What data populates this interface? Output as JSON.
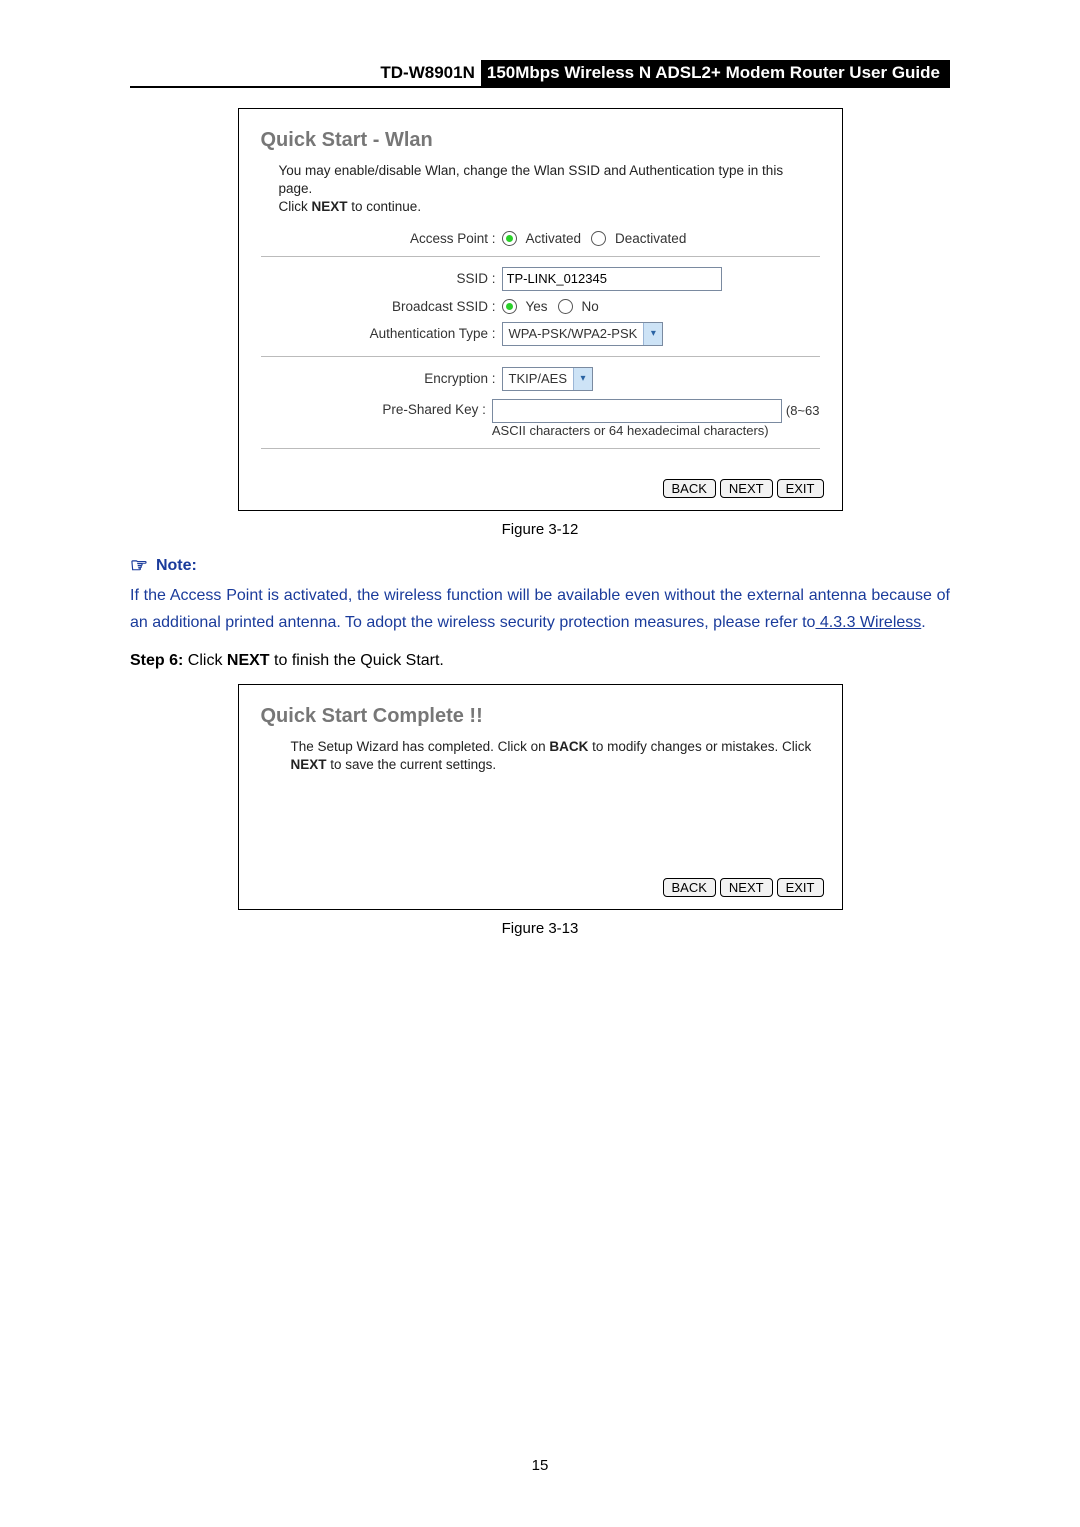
{
  "header": {
    "model": "TD-W8901N",
    "title": "150Mbps Wireless N ADSL2+ Modem Router User Guide"
  },
  "panel1": {
    "title": "Quick Start - Wlan",
    "desc_a": "You may enable/disable Wlan, change the Wlan SSID and Authentication type in this page.",
    "desc_b": "Click ",
    "desc_next": "NEXT",
    "desc_c": " to continue.",
    "ap_label": "Access Point :",
    "ap_activated": "Activated",
    "ap_deactivated": "Deactivated",
    "ssid_label": "SSID :",
    "ssid_value": "TP-LINK_012345",
    "bssid_label": "Broadcast SSID :",
    "bssid_yes": "Yes",
    "bssid_no": "No",
    "auth_label": "Authentication Type :",
    "auth_value": "WPA-PSK/WPA2-PSK",
    "enc_label": "Encryption :",
    "enc_value": "TKIP/AES",
    "psk_label": "Pre-Shared Key :",
    "psk_hint_a": "(8~63",
    "psk_hint_b": "ASCII characters or 64 hexadecimal characters)",
    "btn_back": "BACK",
    "btn_next": "NEXT",
    "btn_exit": "EXIT"
  },
  "fig1": "Figure 3-12",
  "note": {
    "label": "Note:",
    "body_a": "If the Access Point is activated, the wireless function will be available even without the external antenna because of an additional printed antenna. To adopt the wireless security protection measures, please refer to",
    "link": " 4.3.3 Wireless",
    "body_b": "."
  },
  "step6": {
    "prefix": "Step 6:",
    "a": "  Click ",
    "kw": "NEXT",
    "b": " to finish the Quick Start."
  },
  "panel2": {
    "title": "Quick Start Complete !!",
    "desc_a": "The Setup Wizard has completed. Click on ",
    "back_kw": "BACK",
    "desc_b": " to modify changes or mistakes. Click ",
    "next_kw": "NEXT",
    "desc_c": " to save the current settings.",
    "btn_back": "BACK",
    "btn_next": "NEXT",
    "btn_exit": "EXIT"
  },
  "fig2": "Figure 3-13",
  "page_number": "15"
}
